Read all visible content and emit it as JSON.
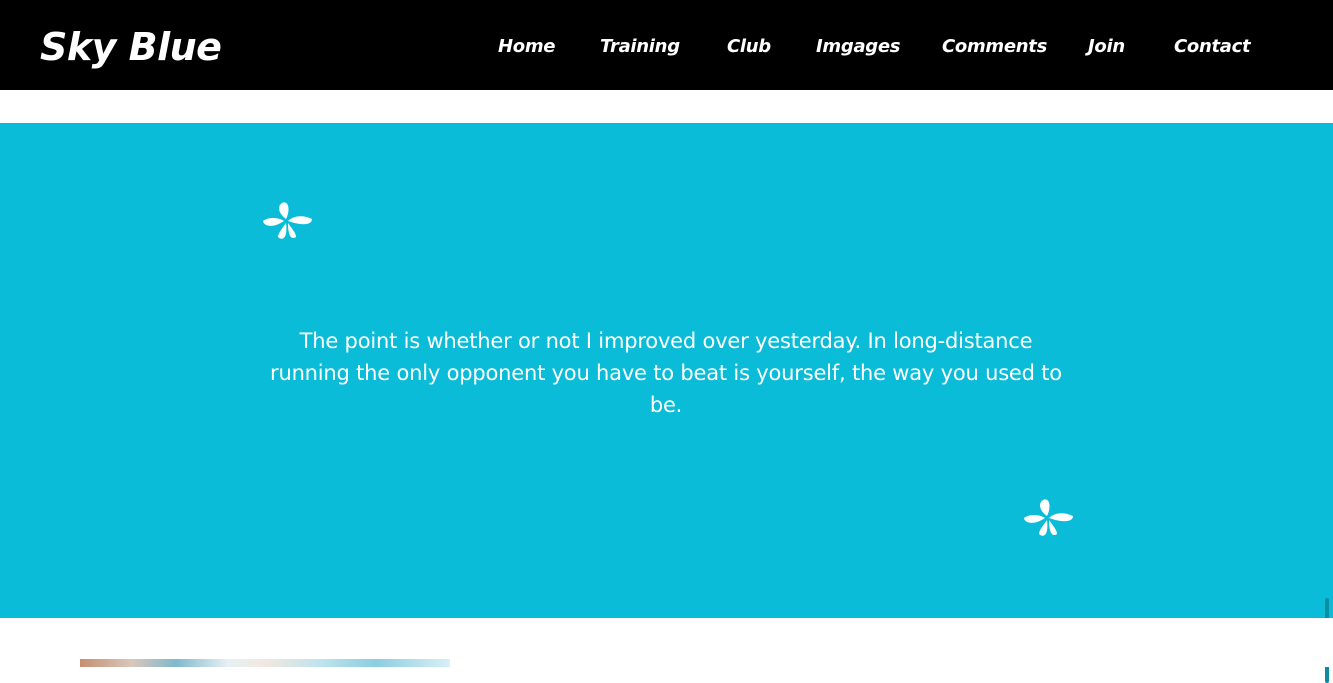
{
  "header": {
    "logo": "Sky Blue",
    "nav": [
      {
        "label": "Home"
      },
      {
        "label": "Training"
      },
      {
        "label": "Club"
      },
      {
        "label": "Imgages"
      },
      {
        "label": "Comments"
      },
      {
        "label": "Join"
      },
      {
        "label": "Contact"
      }
    ]
  },
  "testimonial": {
    "quote": "The point is whether or not I improved over yesterday. In long-distance running the only opponent you have to beat is yourself, the way you used to be.",
    "open_icon": "quote-flower-icon",
    "close_icon": "quote-flower-icon"
  },
  "colors": {
    "header_bg": "#000000",
    "accent": "#0bbcd9",
    "text": "#ffffff"
  }
}
